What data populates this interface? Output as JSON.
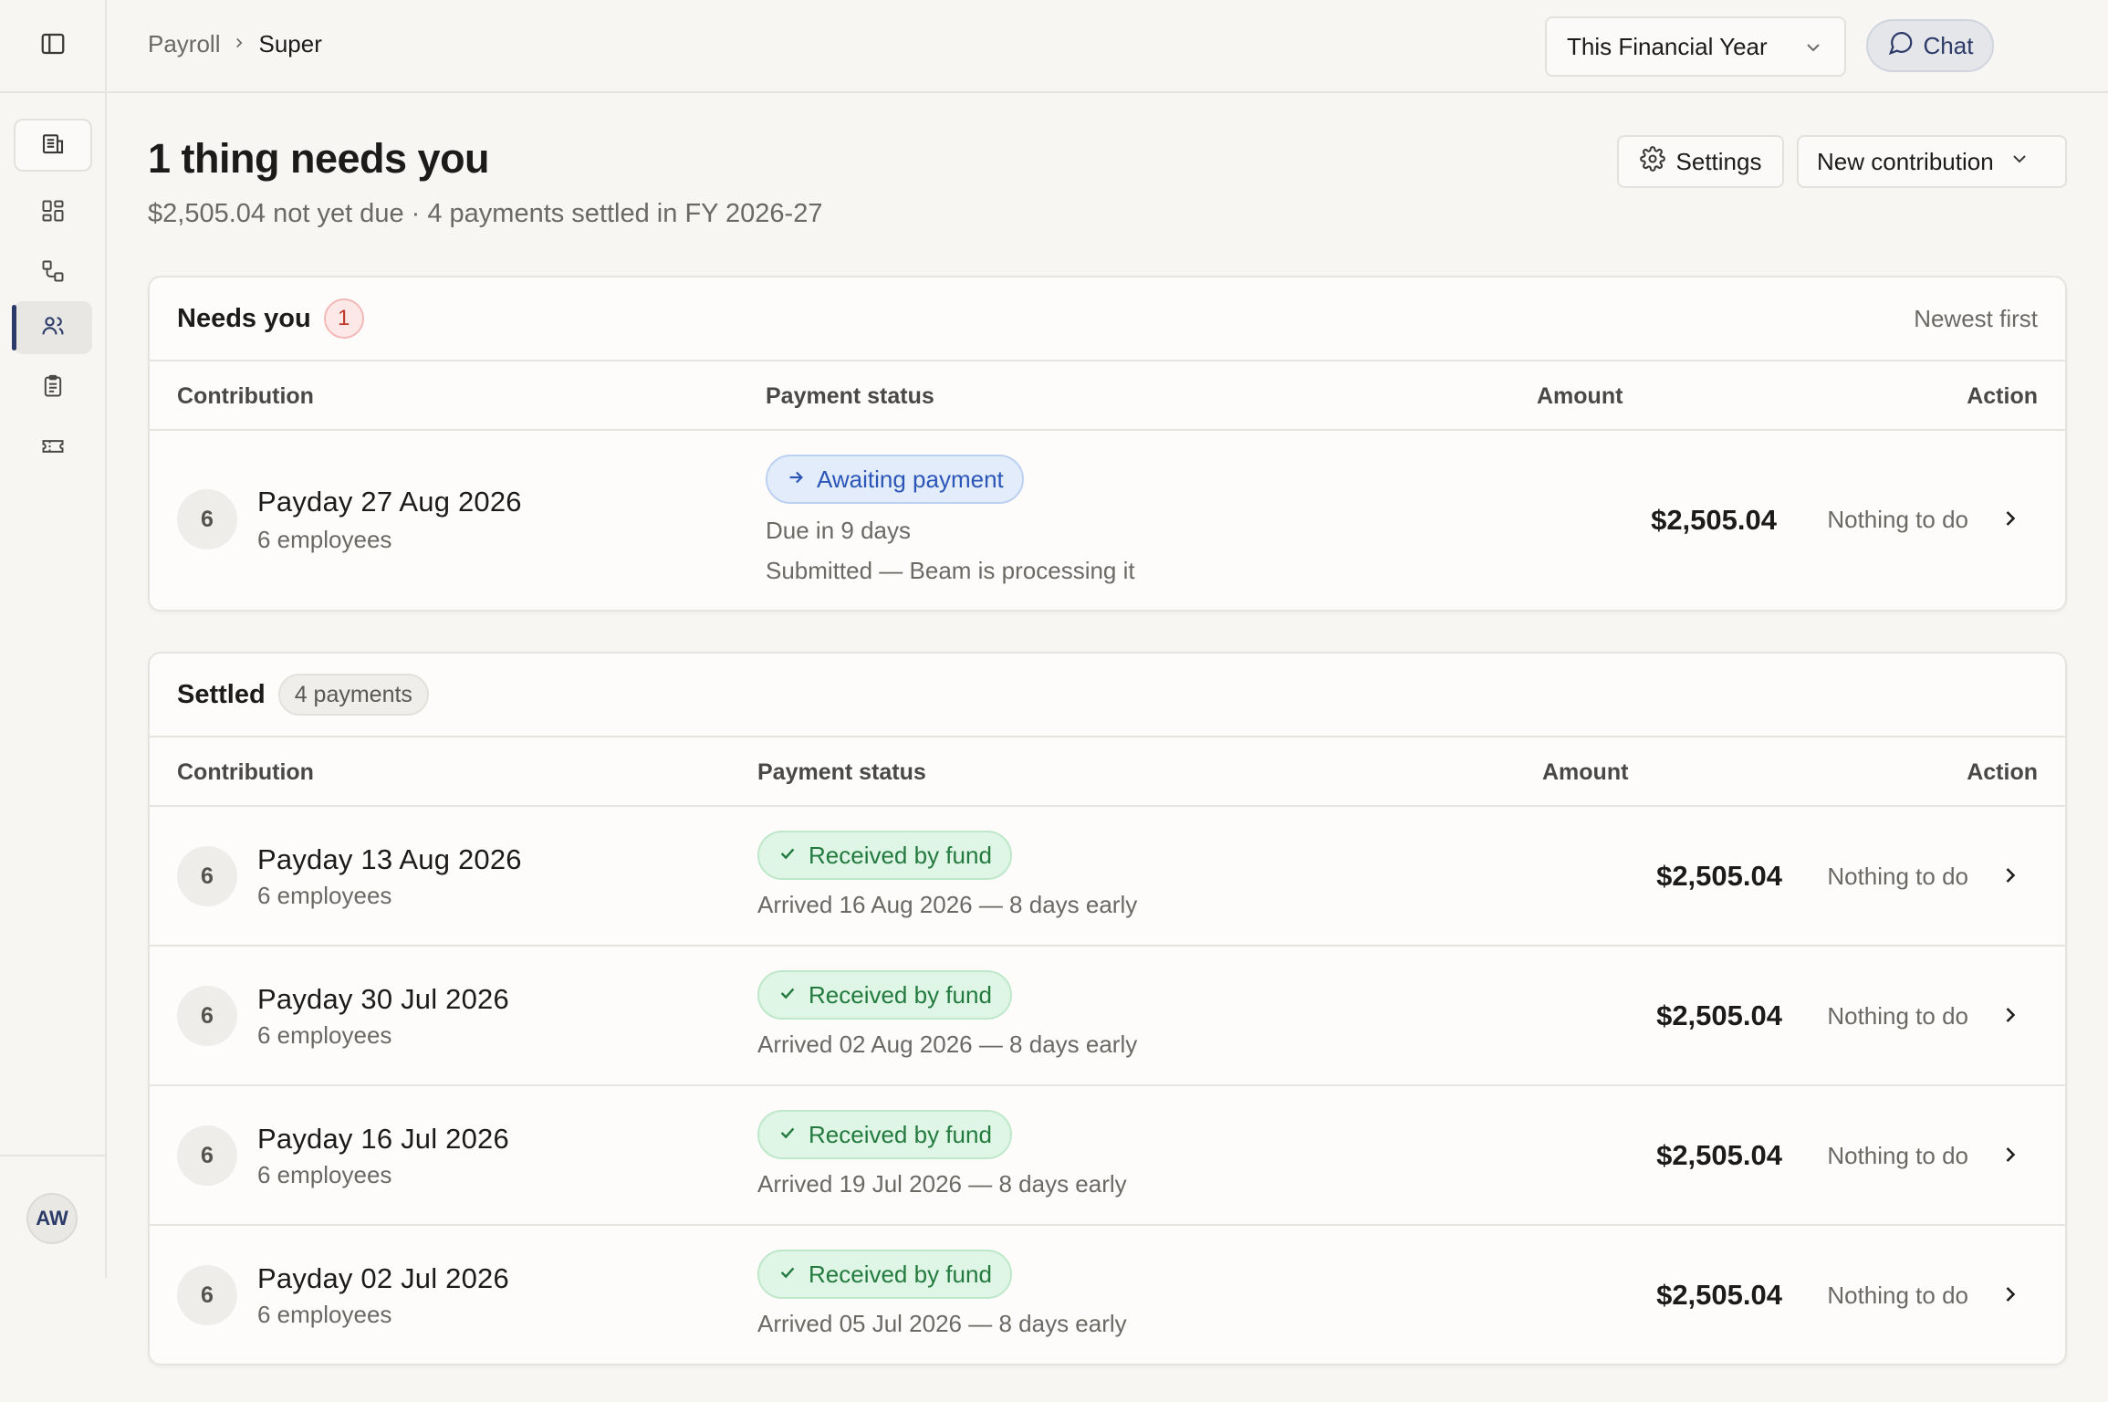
{
  "breadcrumb": {
    "parent": "Payroll",
    "current": "Super"
  },
  "header": {
    "period_select": "This Financial Year",
    "chat_label": "Chat",
    "avatar_initials": "AW"
  },
  "page": {
    "title": "1 thing needs you",
    "subtitle": "$2,505.04 not yet due · 4 payments settled in FY 2026-27",
    "settings_label": "Settings",
    "new_contribution_label": "New contribution"
  },
  "needs_you": {
    "title": "Needs you",
    "count": "1",
    "sort_label": "Newest first",
    "columns": {
      "contribution": "Contribution",
      "status": "Payment status",
      "amount": "Amount",
      "action": "Action"
    },
    "rows": [
      {
        "count": "6",
        "title": "Payday 27 Aug 2026",
        "employees": "6 employees",
        "status": "Awaiting payment",
        "line1": "Due in 9 days",
        "line2": "Submitted — Beam is processing it",
        "amount": "$2,505.04",
        "action": "Nothing to do"
      }
    ]
  },
  "settled": {
    "title": "Settled",
    "count_label": "4 payments",
    "columns": {
      "contribution": "Contribution",
      "status": "Payment status",
      "amount": "Amount",
      "action": "Action"
    },
    "rows": [
      {
        "count": "6",
        "title": "Payday 13 Aug 2026",
        "employees": "6 employees",
        "status": "Received by fund",
        "line1": "Arrived 16 Aug 2026 — 8 days early",
        "amount": "$2,505.04",
        "action": "Nothing to do"
      },
      {
        "count": "6",
        "title": "Payday 30 Jul 2026",
        "employees": "6 employees",
        "status": "Received by fund",
        "line1": "Arrived 02 Aug 2026 — 8 days early",
        "amount": "$2,505.04",
        "action": "Nothing to do"
      },
      {
        "count": "6",
        "title": "Payday 16 Jul 2026",
        "employees": "6 employees",
        "status": "Received by fund",
        "line1": "Arrived 19 Jul 2026 — 8 days early",
        "amount": "$2,505.04",
        "action": "Nothing to do"
      },
      {
        "count": "6",
        "title": "Payday 02 Jul 2026",
        "employees": "6 employees",
        "status": "Received by fund",
        "line1": "Arrived 05 Jul 2026 — 8 days early",
        "amount": "$2,505.04",
        "action": "Nothing to do"
      }
    ]
  },
  "icons": {
    "sidebar_toggle": "panel-left-icon",
    "nav": [
      "building-icon",
      "dashboard-grid-icon",
      "workflow-icon",
      "users-icon",
      "clipboard-icon",
      "ticket-icon"
    ],
    "chat": "message-circle-icon",
    "bell": "bell-icon",
    "settings": "gear-icon"
  },
  "colors": {
    "accent": "#2b3a67",
    "awaiting": "#2b56b8",
    "received": "#237a3f",
    "alert": "#c0392b"
  }
}
